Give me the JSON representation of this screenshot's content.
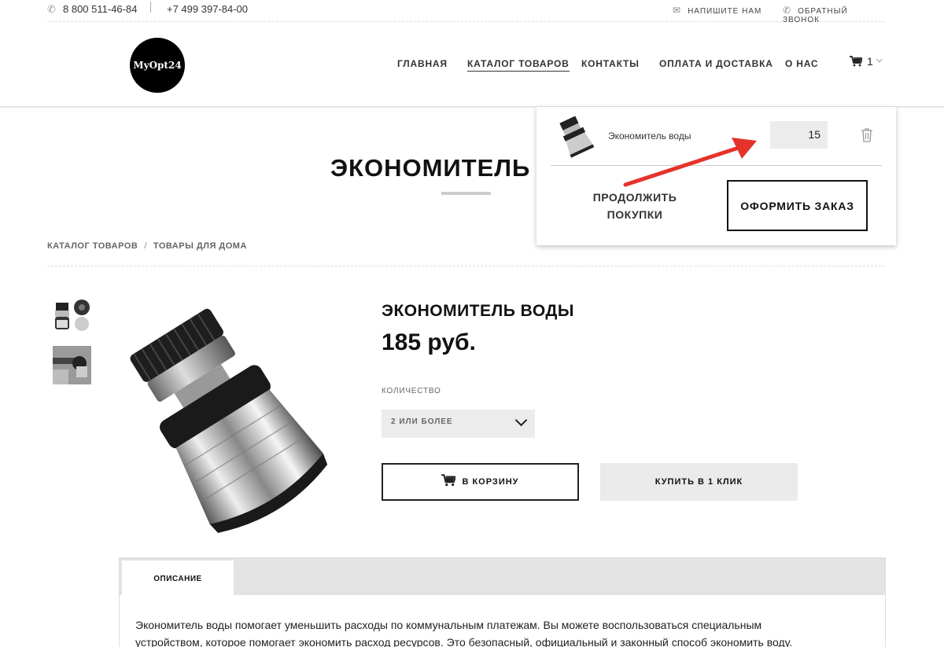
{
  "topbar": {
    "phone1": "8 800 511-46-84",
    "phone2": "+7 499 397-84-00",
    "write_us": "НАПИШИТЕ НАМ",
    "callback": "ОБРАТНЫЙ ЗВОНОК"
  },
  "header": {
    "logo_text": "MyOpt24",
    "nav": [
      "ГЛАВНАЯ",
      "КАТАЛОГ ТОВАРОВ",
      "КОНТАКТЫ",
      "ОПЛАТА И ДОСТАВКА",
      "О НАС"
    ],
    "active_nav": "КАТАЛОГ ТОВАРОВ",
    "cart_count": "1"
  },
  "page": {
    "title": "ЭКОНОМИТЕЛЬ В",
    "breadcrumb": [
      "КАТАЛОГ ТОВАРОВ",
      "ТОВАРЫ ДЛЯ ДОМА"
    ]
  },
  "product": {
    "name": "ЭКОНОМИТЕЛЬ ВОДЫ",
    "price": "185 руб.",
    "qty_label": "КОЛИЧЕСТВО",
    "qty_option": "2 ИЛИ БОЛЕЕ",
    "add_to_cart": "В КОРЗИНУ",
    "buy_one_click": "КУПИТЬ В 1 КЛИК"
  },
  "tabs": {
    "description_tab": "ОПИСАНИЕ",
    "description_line1": "Экономитель воды помогает уменьшить расходы по коммунальным платежам. Вы можете воспользоваться специальным",
    "description_line2": "устройством, которое помогает экономить расход ресурсов. Это безопасный, официальный и законный способ экономить воду."
  },
  "cart_popup": {
    "item_name": "Экономитель воды",
    "item_qty": "15",
    "continue_line1": "ПРОДОЛЖИТЬ",
    "continue_line2": "ПОКУПКИ",
    "checkout": "ОФОРМИТЬ ЗАКАЗ"
  },
  "colors": {
    "accent_arrow": "#e5332a",
    "button_gray": "#ebebeb",
    "text_dark": "#111111"
  }
}
